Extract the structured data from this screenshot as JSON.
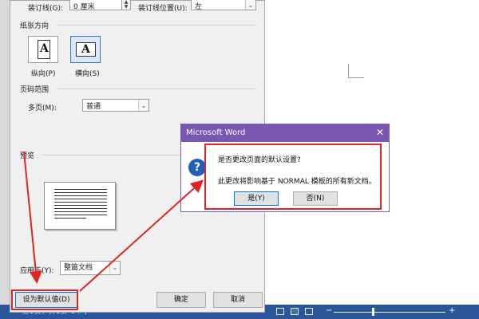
{
  "page_setup": {
    "gutter_label": "装订线(G):",
    "gutter_value": "0 厘米",
    "gutter_position_label": "装订线位置(U):",
    "gutter_position_value": "左",
    "orientation_section": "纸张方向",
    "portrait_label": "纵向(P)",
    "landscape_label": "横向(S)",
    "orientation_glyph": "A",
    "pages_section": "页码范围",
    "multiple_pages_label": "多页(M):",
    "multiple_pages_value": "普通",
    "preview_section": "预览",
    "apply_to_label": "应用于(Y):",
    "apply_to_value": "整篇文档",
    "set_default_label": "设为默认值(D)",
    "ok_label": "确定",
    "cancel_label": "取消"
  },
  "message_box": {
    "title": "Microsoft Word",
    "close_glyph": "✕",
    "question_glyph": "?",
    "line1": "是否更改页面的默认设置?",
    "line2": "此更改将影响基于 NORMAL 模板的所有新文档。",
    "yes_label": "是(Y)",
    "no_label": "否(N)"
  },
  "status_bar": {
    "text": "第1页，共1页    0个字"
  },
  "colors": {
    "annotation_red": "#e02424",
    "dialog_title_purple": "#7a57b0",
    "status_bar_blue": "#2b579a",
    "question_icon_blue": "#1f5fc0"
  },
  "icons": {
    "message_icon": "question-icon",
    "close": "close-icon",
    "dropdown": "chevron-down-icon",
    "spinner": "spin-arrows-icon"
  }
}
